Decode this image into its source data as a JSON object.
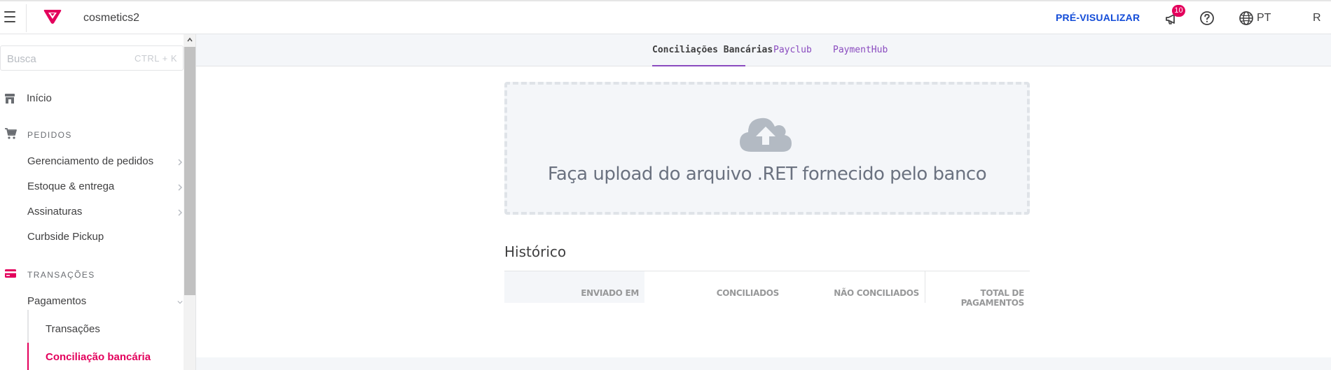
{
  "header": {
    "account_name": "cosmetics2",
    "preview_label": "PRÉ-VISUALIZAR",
    "notifications_count": "10",
    "language": "PT",
    "user_initial": "R",
    "brand_color": "#e3005c",
    "link_color": "#134cd8"
  },
  "sidebar": {
    "search_placeholder": "Busca",
    "search_shortcut": "CTRL + K",
    "home_label": "Início",
    "sections": [
      {
        "label": "PEDIDOS",
        "items": [
          {
            "label": "Gerenciamento de pedidos",
            "has_children": true
          },
          {
            "label": "Estoque & entrega",
            "has_children": true
          },
          {
            "label": "Assinaturas",
            "has_children": true
          },
          {
            "label": "Curbside Pickup",
            "has_children": false
          }
        ]
      },
      {
        "label": "TRANSAÇÕES",
        "items": [
          {
            "label": "Pagamentos",
            "expanded": true
          }
        ],
        "subitems": [
          {
            "label": "Transações",
            "active": false
          },
          {
            "label": "Conciliação bancária",
            "active": true
          }
        ]
      }
    ]
  },
  "main": {
    "tabs": [
      {
        "label": "Conciliações Bancárias",
        "active": true
      },
      {
        "label": "Payclub",
        "active": false
      },
      {
        "label": "PaymentHub",
        "active": false
      }
    ],
    "upload_text": "Faça upload do arquivo .RET fornecido pelo banco",
    "history_title": "Histórico",
    "history_columns": [
      "ENVIADO EM",
      "CONCILIADOS",
      "NÃO CONCILIADOS",
      "TOTAL DE PAGAMENTOS"
    ]
  },
  "icons": {
    "menu": "hamburger-icon",
    "notifications": "megaphone-icon",
    "help": "help-circle-icon",
    "language": "globe-icon",
    "home": "store-icon",
    "orders": "cart-icon",
    "transactions": "credit-card-icon",
    "upload": "cloud-upload-icon"
  }
}
